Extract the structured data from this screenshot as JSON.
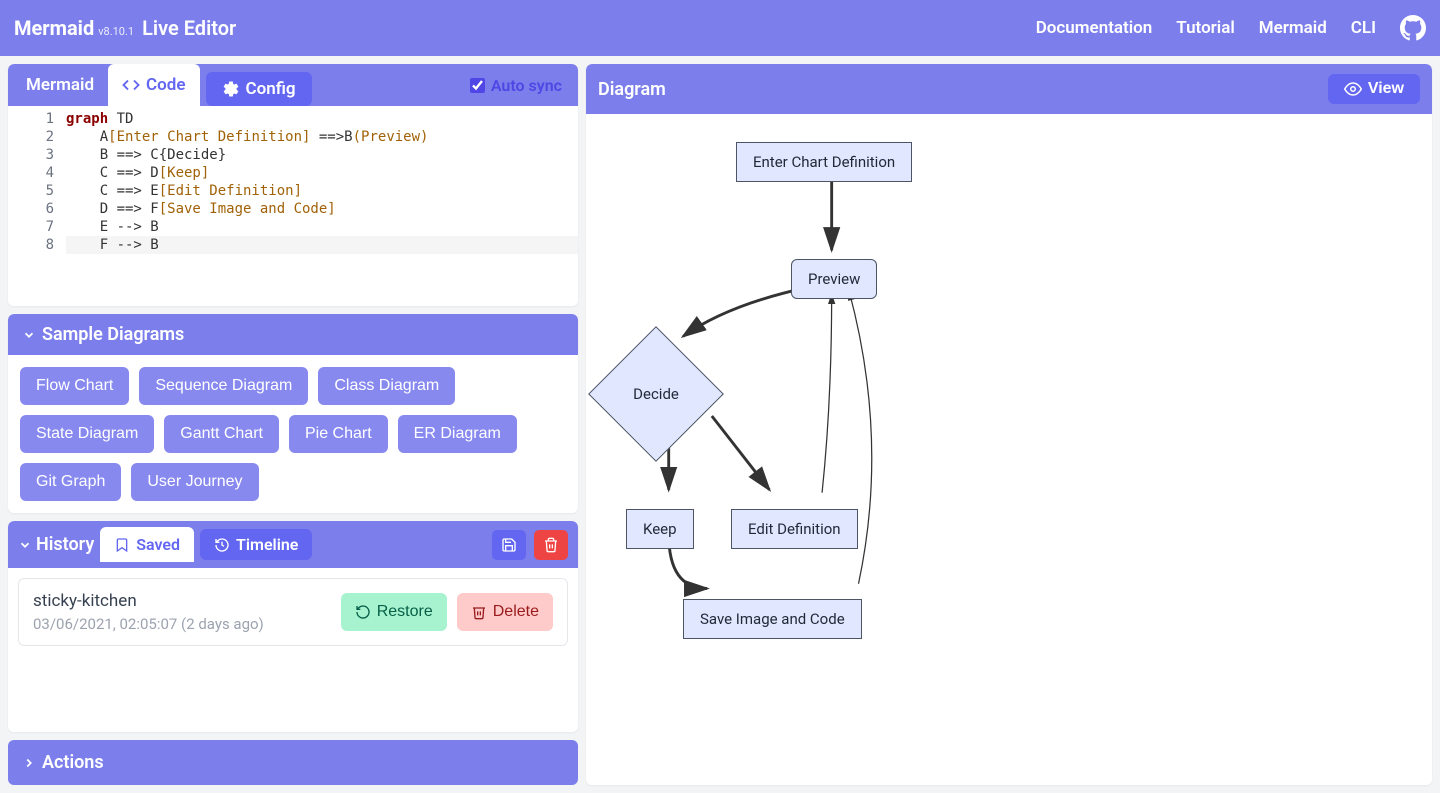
{
  "navbar": {
    "brand": "Mermaid",
    "version": "v8.10.1",
    "subtitle": "Live Editor",
    "links": [
      "Documentation",
      "Tutorial",
      "Mermaid",
      "CLI"
    ]
  },
  "editor": {
    "title_tab": "Mermaid",
    "code_tab": "Code",
    "config_tab": "Config",
    "autosync_label": "Auto sync",
    "autosync_checked": true,
    "line_numbers": [
      "1",
      "2",
      "3",
      "4",
      "5",
      "6",
      "7",
      "8"
    ],
    "code": {
      "l1": {
        "kw": "graph",
        "rest": " TD"
      },
      "l2": {
        "pre": "    A",
        "bracket": "[Enter Chart Definition]",
        "mid": " ==>B",
        "paren": "(Preview)"
      },
      "l3": "    B ==> C{Decide}",
      "l4": {
        "pre": "    C ==> D",
        "bracket": "[Keep]"
      },
      "l5": {
        "pre": "    C ==> E",
        "bracket": "[Edit Definition]"
      },
      "l6": {
        "pre": "    D ==> F",
        "bracket": "[Save Image and Code]"
      },
      "l7": "    E --> B",
      "l8": "    F --> B"
    }
  },
  "samples": {
    "title": "Sample Diagrams",
    "items": [
      "Flow Chart",
      "Sequence Diagram",
      "Class Diagram",
      "State Diagram",
      "Gantt Chart",
      "Pie Chart",
      "ER Diagram",
      "Git Graph",
      "User Journey"
    ]
  },
  "history": {
    "title": "History",
    "saved_tab": "Saved",
    "timeline_tab": "Timeline",
    "item": {
      "name": "sticky-kitchen",
      "meta": "03/06/2021, 02:05:07 (2 days ago)",
      "restore": "Restore",
      "delete": "Delete"
    }
  },
  "actions": {
    "title": "Actions"
  },
  "diagram": {
    "title": "Diagram",
    "view_label": "View",
    "nodes": {
      "A": "Enter Chart Definition",
      "B": "Preview",
      "C": "Decide",
      "D": "Keep",
      "E": "Edit Definition",
      "F": "Save Image and Code"
    }
  }
}
